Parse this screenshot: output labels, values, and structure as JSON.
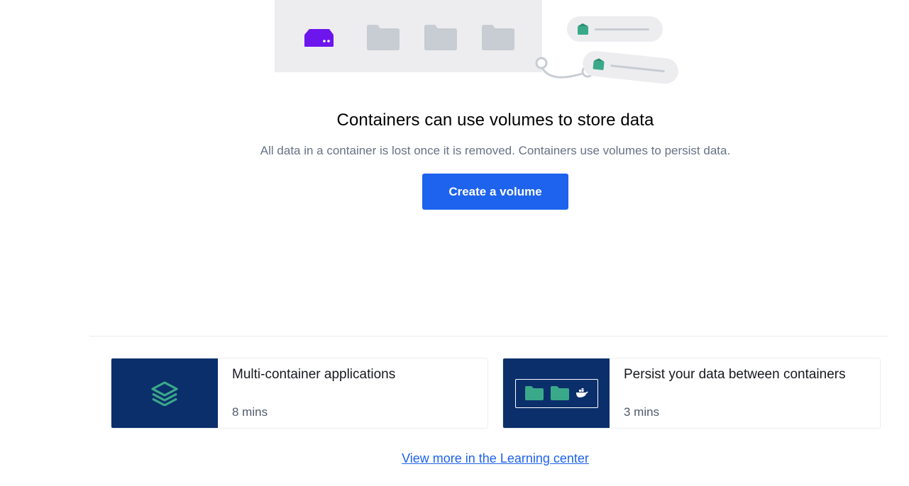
{
  "hero": {
    "title": "Containers can use volumes to store data",
    "subtitle": "All data in a container is lost once it is removed. Containers use volumes to persist data.",
    "create_button_label": "Create a volume"
  },
  "illustration": {
    "icons": [
      "volume-drive-icon",
      "folder-icon",
      "folder-icon",
      "folder-icon",
      "container-tag-icon",
      "container-tag-icon"
    ]
  },
  "learning_cards": [
    {
      "title": "Multi-container applications",
      "duration": "8 mins",
      "thumb_icon": "stack-layers-icon"
    },
    {
      "title": "Persist your data between containers",
      "duration": "3 mins",
      "thumb_icon": "folders-whale-icon"
    }
  ],
  "learning_center_link": "View more in the Learning center",
  "colors": {
    "accent": "#1d63ed",
    "drive": "#6d15ed",
    "card_thumb_bg": "#0b2f6b",
    "teal": "#3aa98a",
    "folder_grey": "#c8ccd3"
  }
}
